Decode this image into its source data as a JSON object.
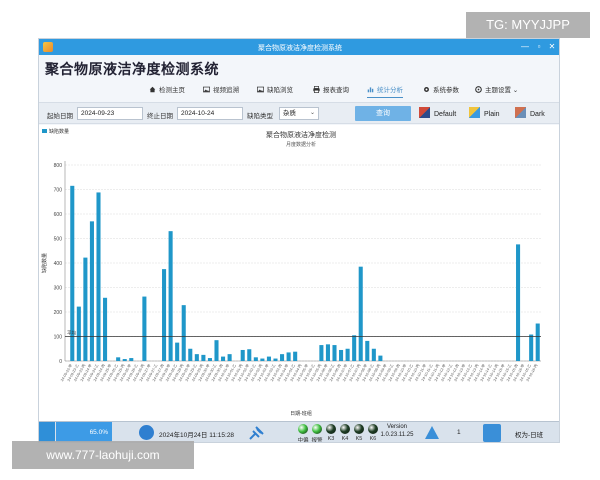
{
  "window": {
    "title": "聚合物原液洁净度检测系统",
    "app_title": "聚合物原液洁净度检测系统",
    "controls": [
      "—",
      "▫",
      "✕"
    ]
  },
  "menu": [
    {
      "label": "检测主页",
      "icon": "home-icon",
      "active": false
    },
    {
      "label": "视频追溯",
      "icon": "image-icon",
      "active": false
    },
    {
      "label": "缺陷浏览",
      "icon": "image-icon",
      "active": false
    },
    {
      "label": "报表查询",
      "icon": "printer-icon",
      "active": false
    },
    {
      "label": "统计分析",
      "icon": "chart-icon",
      "active": true
    },
    {
      "label": "系统参数",
      "icon": "gear-icon",
      "active": false
    },
    {
      "label": "主题设置",
      "icon": "palette-icon",
      "active": false
    }
  ],
  "toolbar": {
    "start_label": "起始日期",
    "start_value": "2024-09-23",
    "end_label": "终止日期",
    "end_value": "2024-10-24",
    "type_label": "缺陷类型",
    "type_value": "杂质",
    "query_label": "查询",
    "themes": [
      {
        "label": "Default",
        "colors": [
          "#d04a3a",
          "#2b4c8c"
        ]
      },
      {
        "label": "Plain",
        "colors": [
          "#f0c43c",
          "#3a9ae0"
        ]
      },
      {
        "label": "Dark",
        "colors": [
          "#d07050",
          "#6a8fb8"
        ]
      }
    ]
  },
  "chart_data": {
    "type": "bar",
    "title": "聚合物原液洁净度检测",
    "subtitle": "月度数据分析",
    "legend": "缺陷数量",
    "xlabel": "日期-班组",
    "ylabel": "缺陷数量",
    "ylim": [
      0,
      800
    ],
    "yticks": [
      0,
      100,
      200,
      300,
      400,
      500,
      600,
      700,
      800
    ],
    "grid": true,
    "reference_line": {
      "value": 100,
      "label": "平均"
    },
    "bar_color": "#1f97c9",
    "categories": [
      "24-09-23-甲",
      "24-09-23-乙",
      "24-09-23-丙",
      "24-09-24-甲",
      "24-09-24-乙",
      "24-09-24-丙",
      "24-09-25-甲",
      "24-09-25-乙",
      "24-09-25-丙",
      "24-09-26-甲",
      "24-09-26-乙",
      "24-09-26-丙",
      "24-09-27-甲",
      "24-09-27-乙",
      "24-09-27-丙",
      "24-09-28-甲",
      "24-09-28-乙",
      "24-09-28-丙",
      "24-09-29-甲",
      "24-09-29-乙",
      "24-09-29-丙",
      "24-09-30-甲",
      "24-09-30-乙",
      "24-09-30-丙",
      "24-10-01-甲",
      "24-10-01-乙",
      "24-10-01-丙",
      "24-10-02-甲",
      "24-10-02-乙",
      "24-10-02-丙",
      "24-10-03-甲",
      "24-10-03-乙",
      "24-10-03-丙",
      "24-10-04-甲",
      "24-10-04-乙",
      "24-10-04-丙",
      "24-10-05-甲",
      "24-10-05-乙",
      "24-10-05-丙",
      "24-10-06-甲",
      "24-10-06-乙",
      "24-10-06-丙",
      "24-10-07-甲",
      "24-10-07-乙",
      "24-10-07-丙",
      "24-10-08-甲",
      "24-10-08-乙",
      "24-10-08-丙",
      "24-10-09-甲",
      "24-10-09-乙",
      "24-10-09-丙",
      "24-10-10-甲",
      "24-10-10-乙",
      "24-10-10-丙",
      "24-10-11-甲",
      "24-10-11-乙",
      "24-10-11-丙",
      "24-10-12-甲",
      "24-10-12-乙",
      "24-10-12-丙",
      "24-10-13-甲",
      "24-10-13-乙",
      "24-10-13-丙",
      "24-10-14-甲",
      "24-10-14-乙",
      "24-10-14-丙",
      "24-10-15-甲",
      "24-10-15-乙",
      "24-10-15-丙",
      "24-10-16-甲",
      "24-10-16-乙",
      "24-10-16-丙"
    ],
    "values": [
      715,
      222,
      422,
      570,
      688,
      258,
      0,
      15,
      8,
      12,
      0,
      263,
      0,
      0,
      375,
      530,
      75,
      228,
      50,
      28,
      25,
      12,
      85,
      18,
      28,
      0,
      45,
      48,
      15,
      10,
      18,
      10,
      28,
      35,
      38,
      0,
      0,
      0,
      65,
      68,
      65,
      45,
      50,
      105,
      385,
      82,
      50,
      22,
      0,
      0,
      0,
      0,
      0,
      0,
      0,
      0,
      0,
      0,
      0,
      0,
      0,
      0,
      0,
      0,
      0,
      0,
      0,
      0,
      476,
      0,
      108,
      153
    ]
  },
  "status": {
    "progress_text": "65.0%",
    "progress_value": 0.65,
    "time": "2024年10月24日 11:15:28",
    "leds": [
      {
        "label": "中偏",
        "color": "#3fbf3f"
      },
      {
        "label": "报警",
        "color": "#3fbf3f"
      },
      {
        "label": "K3",
        "color": "#1e3d24"
      },
      {
        "label": "K4",
        "color": "#1e3d24"
      },
      {
        "label": "K5",
        "color": "#1e3d24"
      },
      {
        "label": "K6",
        "color": "#1e3d24"
      }
    ],
    "version_label": "Version",
    "version_value": "1.0.23.11.25",
    "alarm_count": "1",
    "role": "权为-日班"
  },
  "overlays": {
    "tg": "TG: MYYJJPP",
    "url": "www.777-laohuji.com"
  }
}
